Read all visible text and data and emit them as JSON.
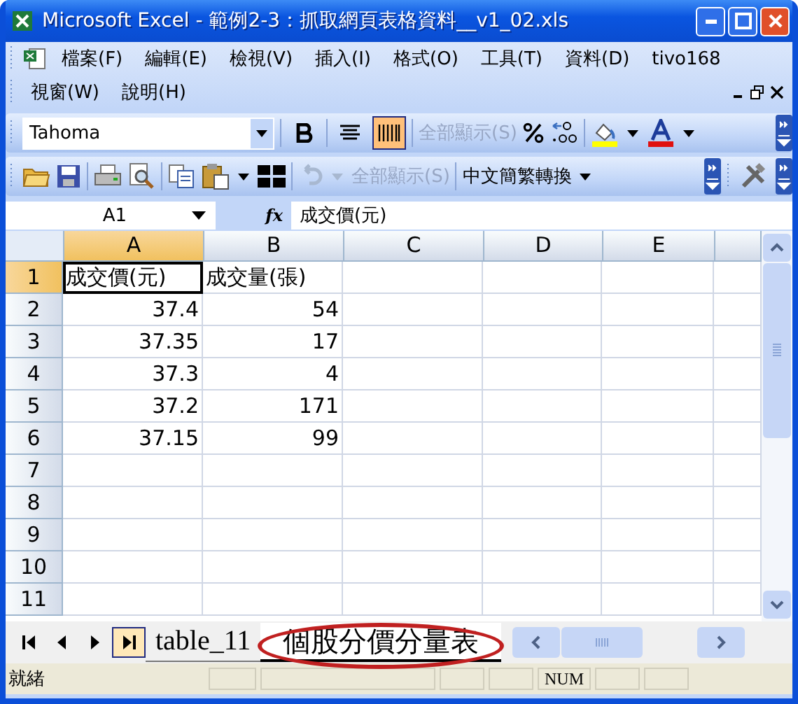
{
  "window": {
    "title": "Microsoft Excel - 範例2-3：抓取網頁表格資料__v1_02.xls"
  },
  "menu": {
    "items": [
      {
        "label": "檔案(F)"
      },
      {
        "label": "編輯(E)"
      },
      {
        "label": "檢視(V)"
      },
      {
        "label": "插入(I)"
      },
      {
        "label": "格式(O)"
      },
      {
        "label": "工具(T)"
      },
      {
        "label": "資料(D)"
      },
      {
        "label": "tivo168"
      },
      {
        "label": "視窗(W)"
      },
      {
        "label": "說明(H)"
      }
    ]
  },
  "formatting_toolbar": {
    "font": "Tahoma",
    "distributed_selected": true,
    "show_all": {
      "label": "全部顯示(S)",
      "disabled": true
    }
  },
  "standard_toolbar": {
    "show_all": {
      "label": "全部顯示(S)",
      "disabled": true
    },
    "convert": {
      "label": "中文簡繁轉換"
    }
  },
  "formula_bar": {
    "name_box": "A1",
    "function_label": "fx",
    "value": "成交價(元)"
  },
  "sheet": {
    "columns": [
      {
        "label": "A",
        "selected": true
      },
      {
        "label": "B",
        "selected": false
      },
      {
        "label": "C",
        "selected": false
      },
      {
        "label": "D",
        "selected": false
      },
      {
        "label": "E",
        "selected": false
      }
    ],
    "rows": [
      {
        "number": "1",
        "selected": true,
        "kind": "text",
        "cells": [
          "成交價(元)",
          "成交量(張)"
        ]
      },
      {
        "number": "2",
        "selected": false,
        "kind": "number",
        "cells": [
          "37.4",
          "54"
        ]
      },
      {
        "number": "3",
        "selected": false,
        "kind": "number",
        "cells": [
          "37.35",
          "17"
        ]
      },
      {
        "number": "4",
        "selected": false,
        "kind": "number",
        "cells": [
          "37.3",
          "4"
        ]
      },
      {
        "number": "5",
        "selected": false,
        "kind": "number",
        "cells": [
          "37.2",
          "171"
        ]
      },
      {
        "number": "6",
        "selected": false,
        "kind": "number",
        "cells": [
          "37.15",
          "99"
        ]
      },
      {
        "number": "7",
        "selected": false,
        "kind": "number",
        "cells": []
      },
      {
        "number": "8",
        "selected": false,
        "kind": "number",
        "cells": []
      },
      {
        "number": "9",
        "selected": false,
        "kind": "number",
        "cells": []
      },
      {
        "number": "10",
        "selected": false,
        "kind": "number",
        "cells": []
      },
      {
        "number": "11",
        "selected": false,
        "kind": "number",
        "cells": []
      }
    ]
  },
  "sheet_tabs": [
    {
      "label": "table_11",
      "selected": false,
      "circled": false
    },
    {
      "label": "個股分價分量表",
      "selected": true,
      "circled": true
    }
  ],
  "status_bar": {
    "status": "就緒",
    "num_lock": "NUM"
  }
}
